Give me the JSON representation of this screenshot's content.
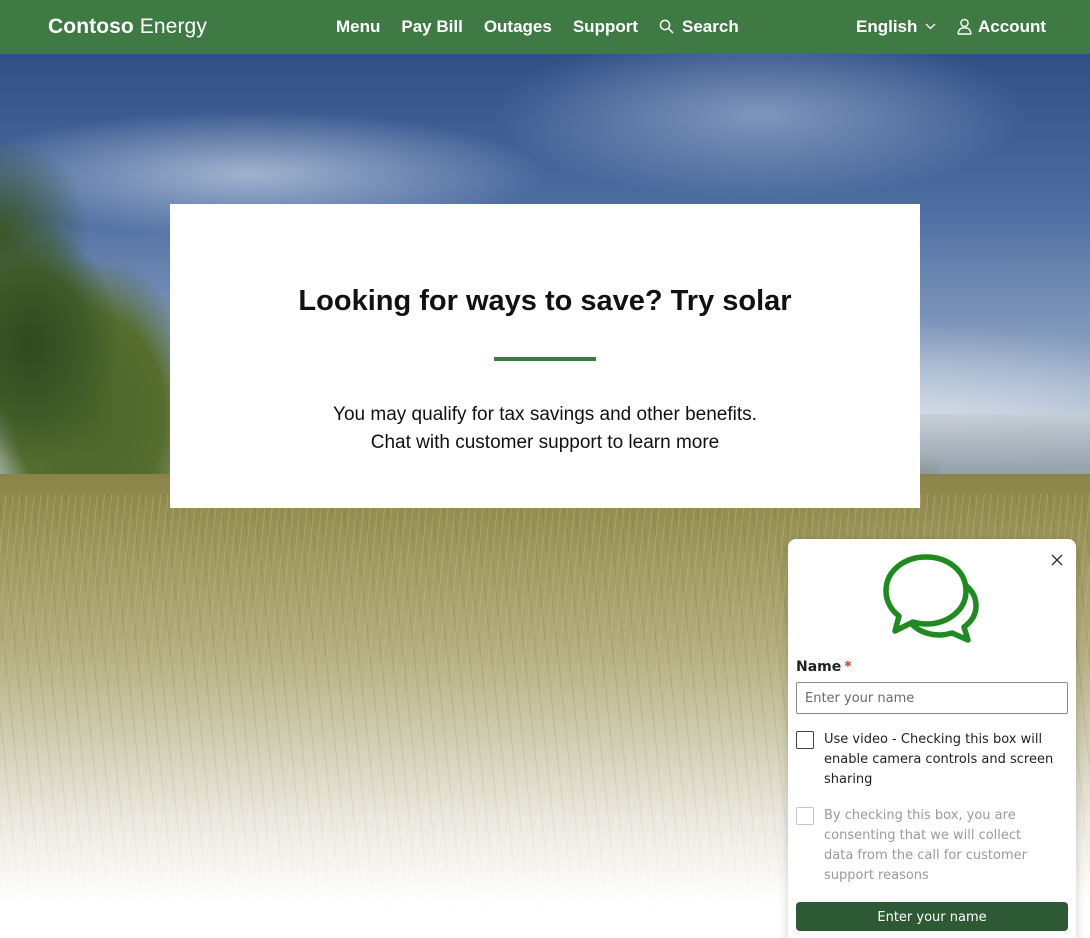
{
  "header": {
    "brand_bold": "Contoso",
    "brand_light": "Energy",
    "nav": {
      "menu": "Menu",
      "pay_bill": "Pay Bill",
      "outages": "Outages",
      "support": "Support",
      "search": "Search"
    },
    "language": "English",
    "account": "Account",
    "bg_color": "#3f7a45"
  },
  "promo": {
    "title": "Looking for ways to save? Try solar",
    "line1": "You may qualify for tax savings and other benefits.",
    "line2": "Chat with customer support to learn more",
    "accent_color": "#3f7a45"
  },
  "chat": {
    "icon": "chat-bubbles-icon",
    "name_label": "Name",
    "required_marker": "*",
    "name_placeholder": "Enter your name",
    "video_label": "Use video - Checking this box will enable camera controls and screen sharing",
    "video_checked": false,
    "consent_label": "By checking this box, you are consenting that we will collect data from the call for customer support reasons",
    "consent_checked": false,
    "consent_disabled": true,
    "submit_label": "Enter your name",
    "submit_color": "#2d5a34",
    "icon_color": "#1f8a1f"
  }
}
